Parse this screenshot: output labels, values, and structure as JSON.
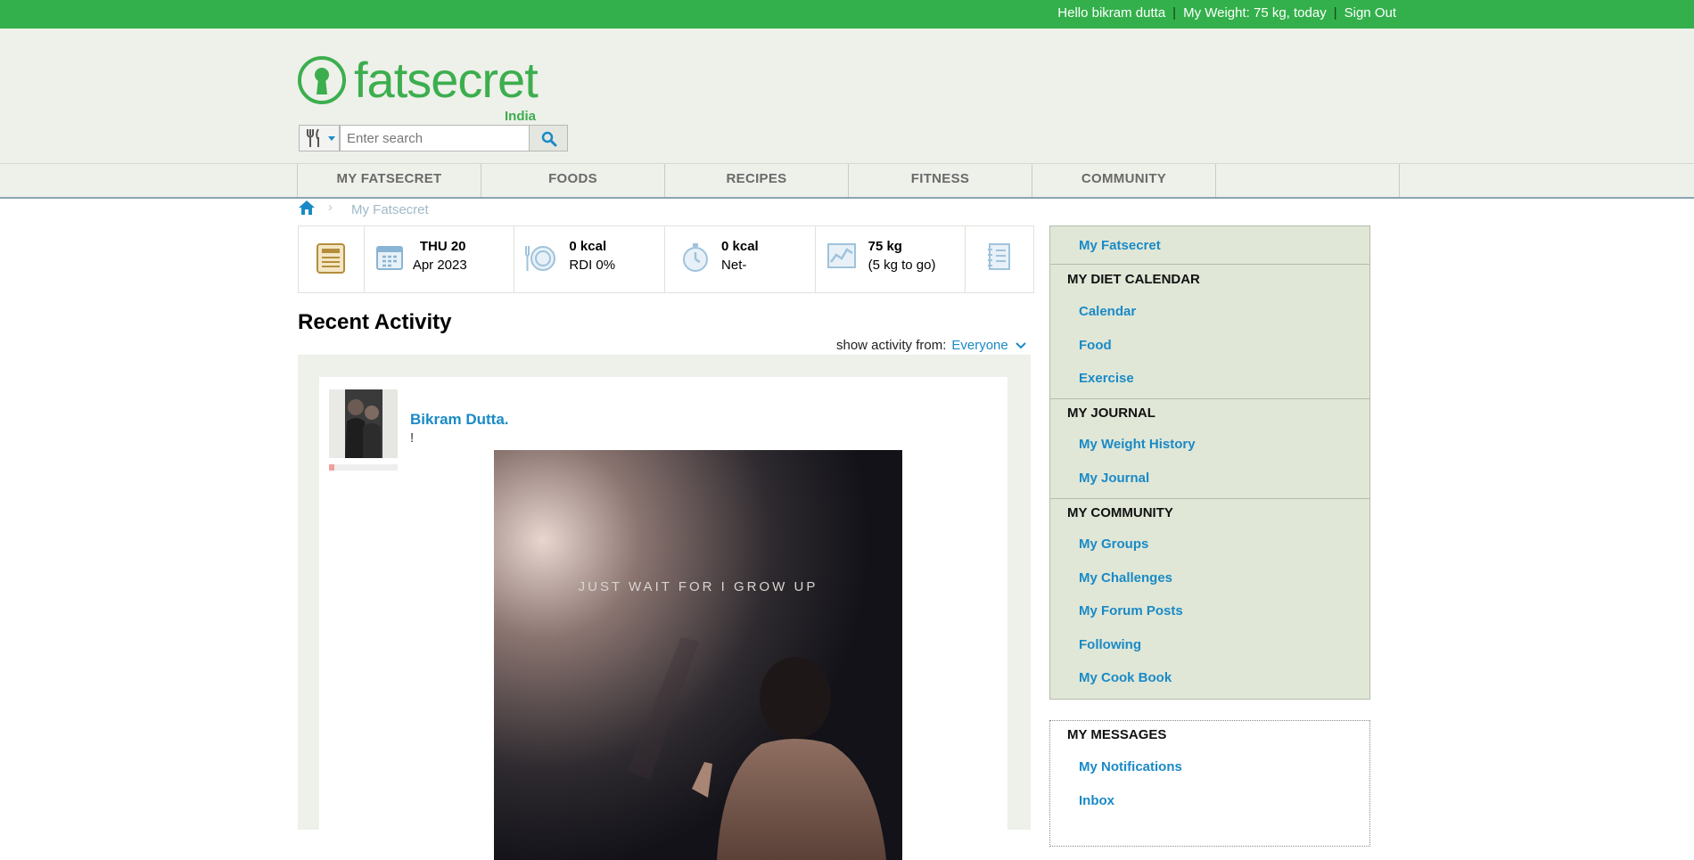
{
  "topbar": {
    "greeting": "Hello bikram dutta",
    "weight": "My Weight: 75 kg, today",
    "sign_out": "Sign Out",
    "separator": "|"
  },
  "logo": {
    "text": "fatsecret",
    "country": "India"
  },
  "search": {
    "placeholder": "Enter search"
  },
  "nav": {
    "items": [
      "MY FATSECRET",
      "FOODS",
      "RECIPES",
      "FITNESS",
      "COMMUNITY"
    ]
  },
  "breadcrumb": {
    "current": "My Fatsecret"
  },
  "stats": {
    "date_day": "THU 20",
    "date_month": "Apr 2023",
    "food_kcal": "0 kcal",
    "food_rdi": "RDI 0%",
    "exercise_kcal": "0 kcal",
    "exercise_net": "Net-",
    "weight": "75 kg",
    "weight_to_go": "(5 kg to go)"
  },
  "activity": {
    "title": "Recent Activity",
    "show_from_label": "show activity from:",
    "show_from_value": "Everyone",
    "post": {
      "author": "Bikram Dutta.",
      "text": "!",
      "image_caption": "JUST WAIT FOR I GROW UP"
    }
  },
  "sidebar": {
    "top_link": "My Fatsecret",
    "diet_calendar": {
      "heading": "MY DIET CALENDAR",
      "links": [
        "Calendar",
        "Food",
        "Exercise"
      ]
    },
    "journal": {
      "heading": "MY JOURNAL",
      "links": [
        "My Weight History",
        "My Journal"
      ]
    },
    "community": {
      "heading": "MY COMMUNITY",
      "links": [
        "My Groups",
        "My Challenges",
        "My Forum Posts",
        "Following",
        "My Cook Book"
      ]
    }
  },
  "messages": {
    "heading": "MY MESSAGES",
    "links": [
      "My Notifications",
      "Inbox"
    ]
  },
  "colors": {
    "brand_green": "#33b04b",
    "link_blue": "#1a8ac6",
    "header_bg": "#eef0ea",
    "sidebar_bg": "#e0e7d7"
  }
}
